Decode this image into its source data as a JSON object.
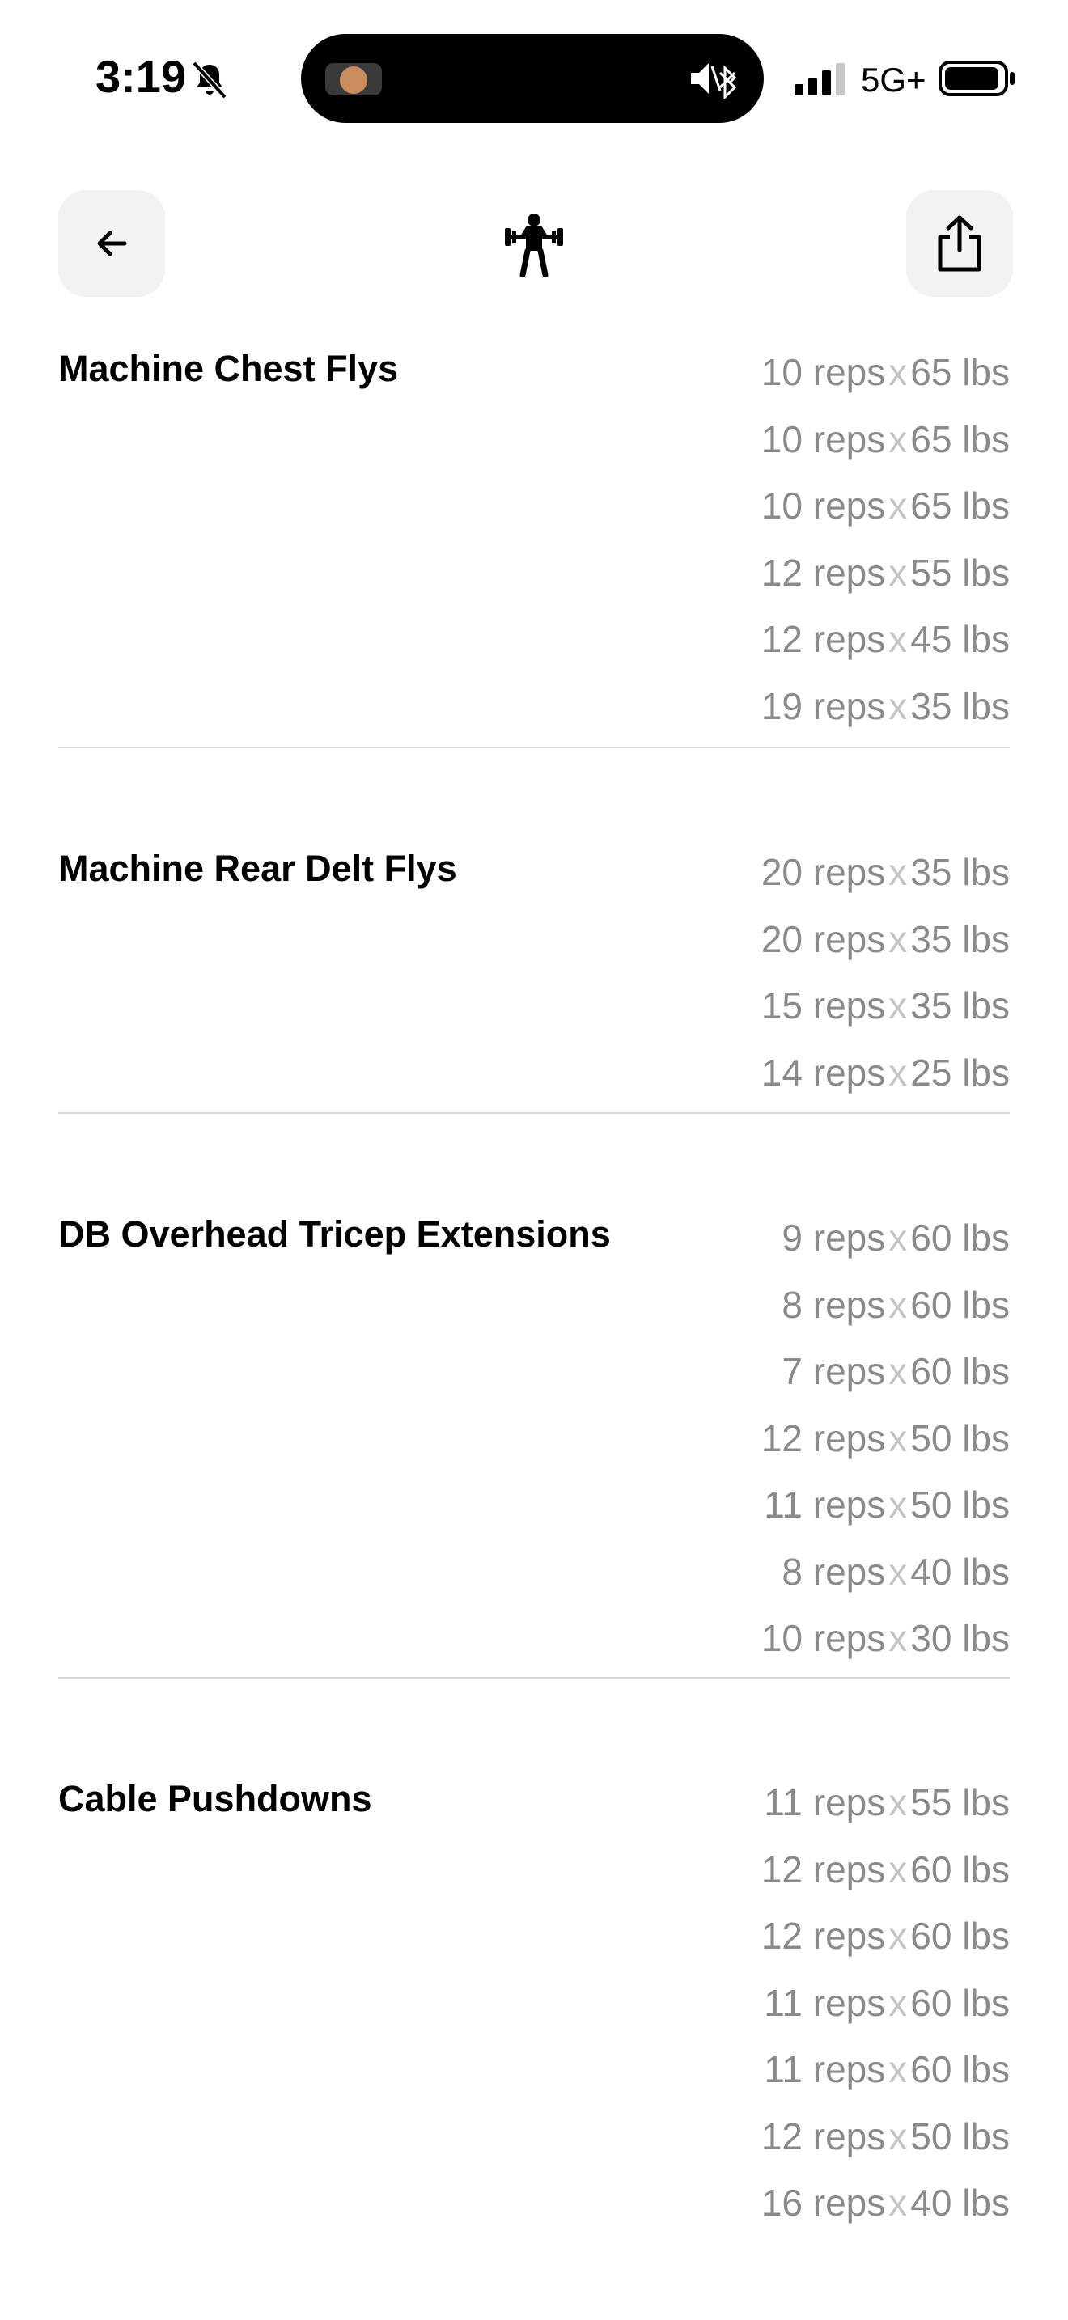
{
  "status_bar": {
    "time": "3:19",
    "network": "5G+",
    "icons": [
      "bell-slash-icon",
      "speaker-muted-icon",
      "bluetooth-icon",
      "cellular-signal-icon",
      "battery-icon"
    ]
  },
  "nav": {
    "back_icon": "arrow-left-icon",
    "center_icon": "weightlifter-icon",
    "share_icon": "share-icon"
  },
  "separator": "x",
  "exercises": [
    {
      "name": "Machine Chest Flys",
      "sets": [
        {
          "reps": "10 reps",
          "weight": "65 lbs"
        },
        {
          "reps": "10 reps",
          "weight": "65 lbs"
        },
        {
          "reps": "10 reps",
          "weight": "65 lbs"
        },
        {
          "reps": "12 reps",
          "weight": "55 lbs"
        },
        {
          "reps": "12 reps",
          "weight": "45 lbs"
        },
        {
          "reps": "19 reps",
          "weight": "35 lbs"
        }
      ]
    },
    {
      "name": "Machine Rear Delt Flys",
      "sets": [
        {
          "reps": "20 reps",
          "weight": "35 lbs"
        },
        {
          "reps": "20 reps",
          "weight": "35 lbs"
        },
        {
          "reps": "15 reps",
          "weight": "35 lbs"
        },
        {
          "reps": "14 reps",
          "weight": "25 lbs"
        }
      ]
    },
    {
      "name": "DB Overhead Tricep Extensions",
      "sets": [
        {
          "reps": "9 reps",
          "weight": "60 lbs"
        },
        {
          "reps": "8 reps",
          "weight": "60 lbs"
        },
        {
          "reps": "7 reps",
          "weight": "60 lbs"
        },
        {
          "reps": "12 reps",
          "weight": "50 lbs"
        },
        {
          "reps": "11 reps",
          "weight": "50 lbs"
        },
        {
          "reps": "8 reps",
          "weight": "40 lbs"
        },
        {
          "reps": "10 reps",
          "weight": "30 lbs"
        }
      ]
    },
    {
      "name": "Cable Pushdowns",
      "sets": [
        {
          "reps": "11 reps",
          "weight": "55 lbs"
        },
        {
          "reps": "12 reps",
          "weight": "60 lbs"
        },
        {
          "reps": "12 reps",
          "weight": "60 lbs"
        },
        {
          "reps": "11 reps",
          "weight": "60 lbs"
        },
        {
          "reps": "11 reps",
          "weight": "60 lbs"
        },
        {
          "reps": "12 reps",
          "weight": "50 lbs"
        },
        {
          "reps": "16 reps",
          "weight": "40 lbs"
        }
      ]
    }
  ]
}
